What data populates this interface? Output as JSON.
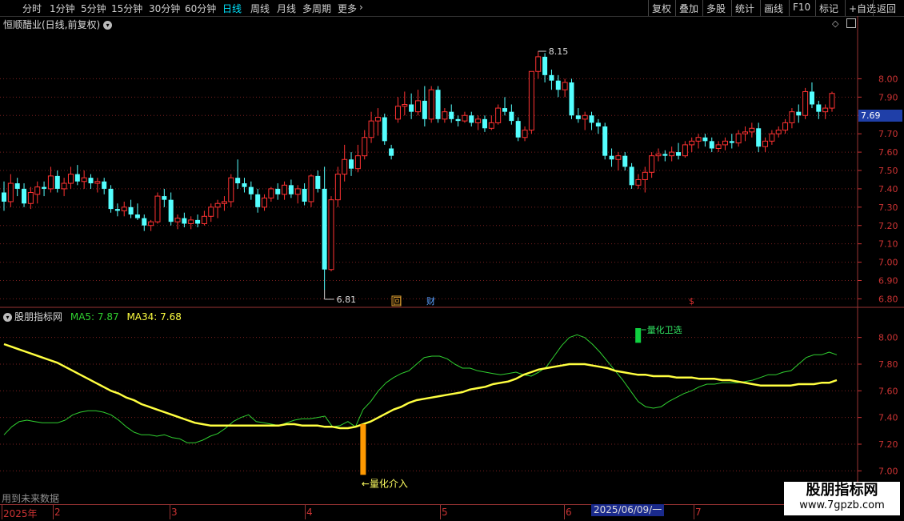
{
  "toolbar": {
    "left_items": [
      {
        "label": "分时",
        "active": false
      },
      {
        "label": "1分钟",
        "active": false
      },
      {
        "label": "5分钟",
        "active": false
      },
      {
        "label": "15分钟",
        "active": false
      },
      {
        "label": "30分钟",
        "active": false
      },
      {
        "label": "60分钟",
        "active": false
      },
      {
        "label": "日线",
        "active": true
      },
      {
        "label": "周线",
        "active": false
      },
      {
        "label": "月线",
        "active": false
      },
      {
        "label": "多周期",
        "active": false
      },
      {
        "label": "更多",
        "active": false
      }
    ],
    "right_items": [
      "复权",
      "叠加",
      "多股",
      "统计",
      "画线",
      "F10",
      "标记",
      "+自选",
      "返回"
    ]
  },
  "main_chart": {
    "title": "恒顺醋业(日线,前复权)",
    "y_ticks": [
      "8.00",
      "7.90",
      "7.80",
      "7.70",
      "7.60",
      "7.50",
      "7.40",
      "7.30",
      "7.20",
      "7.10",
      "7.00",
      "6.90",
      "6.80"
    ],
    "current_price": "7.69",
    "high_label": "8.15",
    "low_label": "6.81",
    "event_markers": [
      {
        "name": "event-marker-hui",
        "label": "回",
        "color": "#e0a030"
      },
      {
        "name": "event-marker-cai",
        "label": "财",
        "color": "#5aa0ff"
      },
      {
        "name": "event-marker-dollar",
        "label": "$",
        "color": "#e03030"
      }
    ]
  },
  "indicator": {
    "name": "股朋指标网",
    "ma5_label": "MA5: 7.87",
    "ma34_label": "MA34: 7.68",
    "y_ticks": [
      "8.00",
      "7.80",
      "7.60",
      "7.40",
      "7.20",
      "7.00"
    ],
    "signal_exit": "量化卫选",
    "signal_entry": "←量化介入"
  },
  "future_data_label": "用到未来数据",
  "date_axis": {
    "labels": [
      "2025年",
      "2",
      "3",
      "4",
      "5",
      "6",
      "7"
    ],
    "cursor_date": "2025/06/09/一"
  },
  "watermark": {
    "title": "股朋指标网",
    "url": "www.7gpzb.com"
  },
  "colors": {
    "up": "#ff3232",
    "down": "#54ffff",
    "ma5": "#30d030",
    "ma34": "#ffff40",
    "entry_signal": "#ff9900",
    "exit_signal": "#10d040"
  },
  "chart_data": [
    {
      "type": "candlestick",
      "title": "恒顺醋业(日线,前复权)",
      "ylim": [
        6.78,
        8.22
      ],
      "candles": [
        {
          "o": 7.38,
          "h": 7.44,
          "l": 7.28,
          "c": 7.33
        },
        {
          "o": 7.33,
          "h": 7.48,
          "l": 7.3,
          "c": 7.43
        },
        {
          "o": 7.43,
          "h": 7.46,
          "l": 7.36,
          "c": 7.4
        },
        {
          "o": 7.4,
          "h": 7.43,
          "l": 7.3,
          "c": 7.32
        },
        {
          "o": 7.32,
          "h": 7.41,
          "l": 7.29,
          "c": 7.38
        },
        {
          "o": 7.37,
          "h": 7.44,
          "l": 7.32,
          "c": 7.41
        },
        {
          "o": 7.41,
          "h": 7.44,
          "l": 7.36,
          "c": 7.4
        },
        {
          "o": 7.4,
          "h": 7.52,
          "l": 7.38,
          "c": 7.47
        },
        {
          "o": 7.47,
          "h": 7.5,
          "l": 7.38,
          "c": 7.4
        },
        {
          "o": 7.4,
          "h": 7.46,
          "l": 7.36,
          "c": 7.43
        },
        {
          "o": 7.43,
          "h": 7.52,
          "l": 7.4,
          "c": 7.48
        },
        {
          "o": 7.48,
          "h": 7.53,
          "l": 7.42,
          "c": 7.44
        },
        {
          "o": 7.44,
          "h": 7.5,
          "l": 7.4,
          "c": 7.46
        },
        {
          "o": 7.46,
          "h": 7.48,
          "l": 7.4,
          "c": 7.43
        },
        {
          "o": 7.43,
          "h": 7.46,
          "l": 7.38,
          "c": 7.44
        },
        {
          "o": 7.44,
          "h": 7.46,
          "l": 7.37,
          "c": 7.4
        },
        {
          "o": 7.4,
          "h": 7.42,
          "l": 7.27,
          "c": 7.29
        },
        {
          "o": 7.29,
          "h": 7.32,
          "l": 7.25,
          "c": 7.28
        },
        {
          "o": 7.28,
          "h": 7.33,
          "l": 7.25,
          "c": 7.3
        },
        {
          "o": 7.3,
          "h": 7.34,
          "l": 7.24,
          "c": 7.26
        },
        {
          "o": 7.26,
          "h": 7.32,
          "l": 7.23,
          "c": 7.24
        },
        {
          "o": 7.24,
          "h": 7.26,
          "l": 7.17,
          "c": 7.2
        },
        {
          "o": 7.2,
          "h": 7.23,
          "l": 7.17,
          "c": 7.22
        },
        {
          "o": 7.22,
          "h": 7.38,
          "l": 7.21,
          "c": 7.36
        },
        {
          "o": 7.36,
          "h": 7.4,
          "l": 7.3,
          "c": 7.34
        },
        {
          "o": 7.34,
          "h": 7.38,
          "l": 7.2,
          "c": 7.22
        },
        {
          "o": 7.22,
          "h": 7.26,
          "l": 7.18,
          "c": 7.24
        },
        {
          "o": 7.24,
          "h": 7.27,
          "l": 7.19,
          "c": 7.21
        },
        {
          "o": 7.21,
          "h": 7.25,
          "l": 7.18,
          "c": 7.23
        },
        {
          "o": 7.23,
          "h": 7.26,
          "l": 7.19,
          "c": 7.21
        },
        {
          "o": 7.21,
          "h": 7.28,
          "l": 7.2,
          "c": 7.25
        },
        {
          "o": 7.25,
          "h": 7.32,
          "l": 7.22,
          "c": 7.3
        },
        {
          "o": 7.3,
          "h": 7.34,
          "l": 7.24,
          "c": 7.32
        },
        {
          "o": 7.32,
          "h": 7.36,
          "l": 7.28,
          "c": 7.33
        },
        {
          "o": 7.33,
          "h": 7.48,
          "l": 7.3,
          "c": 7.46
        },
        {
          "o": 7.46,
          "h": 7.56,
          "l": 7.4,
          "c": 7.43
        },
        {
          "o": 7.43,
          "h": 7.46,
          "l": 7.38,
          "c": 7.41
        },
        {
          "o": 7.41,
          "h": 7.44,
          "l": 7.34,
          "c": 7.37
        },
        {
          "o": 7.37,
          "h": 7.4,
          "l": 7.27,
          "c": 7.3
        },
        {
          "o": 7.3,
          "h": 7.37,
          "l": 7.28,
          "c": 7.35
        },
        {
          "o": 7.35,
          "h": 7.41,
          "l": 7.33,
          "c": 7.4
        },
        {
          "o": 7.4,
          "h": 7.43,
          "l": 7.34,
          "c": 7.37
        },
        {
          "o": 7.37,
          "h": 7.44,
          "l": 7.34,
          "c": 7.42
        },
        {
          "o": 7.42,
          "h": 7.45,
          "l": 7.35,
          "c": 7.37
        },
        {
          "o": 7.37,
          "h": 7.42,
          "l": 7.32,
          "c": 7.4
        },
        {
          "o": 7.4,
          "h": 7.43,
          "l": 7.31,
          "c": 7.33
        },
        {
          "o": 7.33,
          "h": 7.48,
          "l": 7.3,
          "c": 7.47
        },
        {
          "o": 7.47,
          "h": 7.5,
          "l": 7.38,
          "c": 7.4
        },
        {
          "o": 7.4,
          "h": 7.52,
          "l": 6.85,
          "c": 6.96
        },
        {
          "o": 6.96,
          "h": 7.36,
          "l": 6.95,
          "c": 7.34
        },
        {
          "o": 7.34,
          "h": 7.52,
          "l": 7.3,
          "c": 7.48
        },
        {
          "o": 7.48,
          "h": 7.64,
          "l": 7.44,
          "c": 7.56
        },
        {
          "o": 7.56,
          "h": 7.6,
          "l": 7.47,
          "c": 7.51
        },
        {
          "o": 7.51,
          "h": 7.64,
          "l": 7.49,
          "c": 7.58
        },
        {
          "o": 7.58,
          "h": 7.72,
          "l": 7.56,
          "c": 7.68
        },
        {
          "o": 7.68,
          "h": 7.82,
          "l": 7.65,
          "c": 7.77
        },
        {
          "o": 7.77,
          "h": 7.84,
          "l": 7.69,
          "c": 7.79
        },
        {
          "o": 7.79,
          "h": 7.81,
          "l": 7.64,
          "c": 7.66
        },
        {
          "o": 7.62,
          "h": 7.64,
          "l": 7.56,
          "c": 7.58
        },
        {
          "o": 7.78,
          "h": 7.9,
          "l": 7.76,
          "c": 7.85
        },
        {
          "o": 7.85,
          "h": 7.93,
          "l": 7.8,
          "c": 7.86
        },
        {
          "o": 7.86,
          "h": 7.92,
          "l": 7.78,
          "c": 7.82
        },
        {
          "o": 7.82,
          "h": 7.94,
          "l": 7.8,
          "c": 7.88
        },
        {
          "o": 7.88,
          "h": 7.96,
          "l": 7.74,
          "c": 7.78
        },
        {
          "o": 7.78,
          "h": 7.96,
          "l": 7.76,
          "c": 7.94
        },
        {
          "o": 7.94,
          "h": 7.96,
          "l": 7.76,
          "c": 7.78
        },
        {
          "o": 7.78,
          "h": 7.84,
          "l": 7.76,
          "c": 7.82
        },
        {
          "o": 7.82,
          "h": 7.86,
          "l": 7.76,
          "c": 7.78
        },
        {
          "o": 7.78,
          "h": 7.8,
          "l": 7.74,
          "c": 7.77
        },
        {
          "o": 7.77,
          "h": 7.82,
          "l": 7.76,
          "c": 7.8
        },
        {
          "o": 7.8,
          "h": 7.82,
          "l": 7.74,
          "c": 7.76
        },
        {
          "o": 7.76,
          "h": 7.8,
          "l": 7.72,
          "c": 7.78
        },
        {
          "o": 7.78,
          "h": 7.8,
          "l": 7.71,
          "c": 7.73
        },
        {
          "o": 7.73,
          "h": 7.8,
          "l": 7.72,
          "c": 7.76
        },
        {
          "o": 7.76,
          "h": 7.86,
          "l": 7.75,
          "c": 7.84
        },
        {
          "o": 7.84,
          "h": 7.9,
          "l": 7.8,
          "c": 7.82
        },
        {
          "o": 7.82,
          "h": 7.86,
          "l": 7.75,
          "c": 7.77
        },
        {
          "o": 7.77,
          "h": 7.79,
          "l": 7.66,
          "c": 7.68
        },
        {
          "o": 7.68,
          "h": 7.74,
          "l": 7.66,
          "c": 7.72
        },
        {
          "o": 7.72,
          "h": 7.86,
          "l": 7.7,
          "c": 8.04
        },
        {
          "o": 8.04,
          "h": 8.15,
          "l": 8.0,
          "c": 8.12
        },
        {
          "o": 8.12,
          "h": 8.14,
          "l": 7.98,
          "c": 8.02
        },
        {
          "o": 8.02,
          "h": 8.05,
          "l": 7.94,
          "c": 7.99
        },
        {
          "o": 7.99,
          "h": 8.02,
          "l": 7.9,
          "c": 7.94
        },
        {
          "o": 7.94,
          "h": 8.0,
          "l": 7.9,
          "c": 7.98
        },
        {
          "o": 7.98,
          "h": 8.0,
          "l": 7.78,
          "c": 7.8
        },
        {
          "o": 7.8,
          "h": 7.84,
          "l": 7.76,
          "c": 7.78
        },
        {
          "o": 7.78,
          "h": 7.82,
          "l": 7.72,
          "c": 7.8
        },
        {
          "o": 7.8,
          "h": 7.82,
          "l": 7.72,
          "c": 7.76
        },
        {
          "o": 7.76,
          "h": 7.78,
          "l": 7.7,
          "c": 7.74
        },
        {
          "o": 7.74,
          "h": 7.76,
          "l": 7.56,
          "c": 7.58
        },
        {
          "o": 7.58,
          "h": 7.62,
          "l": 7.52,
          "c": 7.56
        },
        {
          "o": 7.56,
          "h": 7.6,
          "l": 7.5,
          "c": 7.58
        },
        {
          "o": 7.58,
          "h": 7.6,
          "l": 7.5,
          "c": 7.52
        },
        {
          "o": 7.52,
          "h": 7.54,
          "l": 7.4,
          "c": 7.42
        },
        {
          "o": 7.42,
          "h": 7.48,
          "l": 7.4,
          "c": 7.45
        },
        {
          "o": 7.45,
          "h": 7.52,
          "l": 7.38,
          "c": 7.49
        },
        {
          "o": 7.49,
          "h": 7.6,
          "l": 7.46,
          "c": 7.58
        },
        {
          "o": 7.58,
          "h": 7.62,
          "l": 7.55,
          "c": 7.59
        },
        {
          "o": 7.59,
          "h": 7.61,
          "l": 7.55,
          "c": 7.58
        },
        {
          "o": 7.58,
          "h": 7.63,
          "l": 7.55,
          "c": 7.6
        },
        {
          "o": 7.6,
          "h": 7.65,
          "l": 7.56,
          "c": 7.58
        },
        {
          "o": 7.58,
          "h": 7.66,
          "l": 7.57,
          "c": 7.64
        },
        {
          "o": 7.64,
          "h": 7.68,
          "l": 7.6,
          "c": 7.66
        },
        {
          "o": 7.66,
          "h": 7.7,
          "l": 7.62,
          "c": 7.68
        },
        {
          "o": 7.68,
          "h": 7.7,
          "l": 7.63,
          "c": 7.66
        },
        {
          "o": 7.66,
          "h": 7.68,
          "l": 7.6,
          "c": 7.62
        },
        {
          "o": 7.62,
          "h": 7.66,
          "l": 7.6,
          "c": 7.64
        },
        {
          "o": 7.64,
          "h": 7.68,
          "l": 7.61,
          "c": 7.66
        },
        {
          "o": 7.66,
          "h": 7.7,
          "l": 7.62,
          "c": 7.65
        },
        {
          "o": 7.65,
          "h": 7.72,
          "l": 7.63,
          "c": 7.7
        },
        {
          "o": 7.7,
          "h": 7.74,
          "l": 7.66,
          "c": 7.71
        },
        {
          "o": 7.71,
          "h": 7.76,
          "l": 7.68,
          "c": 7.73
        },
        {
          "o": 7.73,
          "h": 7.76,
          "l": 7.6,
          "c": 7.63
        },
        {
          "o": 7.63,
          "h": 7.68,
          "l": 7.6,
          "c": 7.66
        },
        {
          "o": 7.66,
          "h": 7.72,
          "l": 7.64,
          "c": 7.7
        },
        {
          "o": 7.7,
          "h": 7.74,
          "l": 7.68,
          "c": 7.72
        },
        {
          "o": 7.72,
          "h": 7.78,
          "l": 7.7,
          "c": 7.76
        },
        {
          "o": 7.76,
          "h": 7.84,
          "l": 7.73,
          "c": 7.82
        },
        {
          "o": 7.82,
          "h": 7.86,
          "l": 7.76,
          "c": 7.8
        },
        {
          "o": 7.8,
          "h": 7.95,
          "l": 7.78,
          "c": 7.93
        },
        {
          "o": 7.93,
          "h": 7.98,
          "l": 7.84,
          "c": 7.86
        },
        {
          "o": 7.86,
          "h": 7.88,
          "l": 7.78,
          "c": 7.82
        },
        {
          "o": 7.82,
          "h": 7.86,
          "l": 7.78,
          "c": 7.84
        },
        {
          "o": 7.84,
          "h": 7.93,
          "l": 7.82,
          "c": 7.92
        }
      ]
    },
    {
      "type": "line",
      "title": "股朋指标网",
      "ylim": [
        6.93,
        8.1
      ],
      "series": [
        {
          "name": "MA5",
          "values": [
            7.27,
            7.33,
            7.37,
            7.38,
            7.37,
            7.36,
            7.36,
            7.36,
            7.38,
            7.42,
            7.44,
            7.45,
            7.45,
            7.44,
            7.42,
            7.38,
            7.33,
            7.29,
            7.27,
            7.27,
            7.26,
            7.27,
            7.25,
            7.24,
            7.21,
            7.21,
            7.23,
            7.26,
            7.28,
            7.32,
            7.37,
            7.4,
            7.42,
            7.37,
            7.36,
            7.35,
            7.34,
            7.36,
            7.38,
            7.39,
            7.39,
            7.4,
            7.41,
            7.33,
            7.34,
            7.37,
            7.33,
            7.46,
            7.52,
            7.6,
            7.66,
            7.7,
            7.73,
            7.75,
            7.8,
            7.85,
            7.86,
            7.86,
            7.84,
            7.8,
            7.77,
            7.77,
            7.75,
            7.74,
            7.73,
            7.72,
            7.73,
            7.74,
            7.72,
            7.71,
            7.74,
            7.78,
            7.86,
            7.94,
            8.0,
            8.02,
            8.0,
            7.95,
            7.89,
            7.82,
            7.75,
            7.68,
            7.6,
            7.52,
            7.48,
            7.47,
            7.48,
            7.52,
            7.55,
            7.58,
            7.6,
            7.63,
            7.65,
            7.65,
            7.66,
            7.66,
            7.66,
            7.67,
            7.68,
            7.7,
            7.72,
            7.72,
            7.74,
            7.75,
            7.8,
            7.85,
            7.87,
            7.87,
            7.89,
            7.87
          ]
        },
        {
          "name": "MA34",
          "values": [
            7.95,
            7.93,
            7.91,
            7.89,
            7.87,
            7.85,
            7.83,
            7.81,
            7.78,
            7.75,
            7.72,
            7.69,
            7.66,
            7.63,
            7.6,
            7.58,
            7.55,
            7.53,
            7.5,
            7.48,
            7.46,
            7.44,
            7.42,
            7.4,
            7.38,
            7.36,
            7.35,
            7.34,
            7.34,
            7.34,
            7.34,
            7.34,
            7.34,
            7.34,
            7.34,
            7.34,
            7.34,
            7.35,
            7.35,
            7.34,
            7.34,
            7.34,
            7.33,
            7.33,
            7.32,
            7.32,
            7.33,
            7.35,
            7.37,
            7.4,
            7.43,
            7.46,
            7.48,
            7.51,
            7.53,
            7.54,
            7.55,
            7.56,
            7.57,
            7.58,
            7.59,
            7.61,
            7.62,
            7.63,
            7.65,
            7.66,
            7.67,
            7.69,
            7.72,
            7.74,
            7.76,
            7.77,
            7.78,
            7.79,
            7.8,
            7.8,
            7.8,
            7.79,
            7.78,
            7.77,
            7.75,
            7.74,
            7.73,
            7.72,
            7.72,
            7.71,
            7.71,
            7.71,
            7.7,
            7.7,
            7.7,
            7.69,
            7.69,
            7.69,
            7.68,
            7.68,
            7.67,
            7.66,
            7.65,
            7.64,
            7.64,
            7.64,
            7.64,
            7.64,
            7.65,
            7.65,
            7.65,
            7.66,
            7.66,
            7.68
          ]
        }
      ],
      "signals": [
        {
          "label": "←量化介入",
          "index": 47,
          "from": 6.97,
          "to": 7.35,
          "color": "#ff9900"
        },
        {
          "label": "量化卫选",
          "index": 83,
          "from": 7.96,
          "to": 8.07,
          "color": "#10d040"
        }
      ]
    }
  ]
}
